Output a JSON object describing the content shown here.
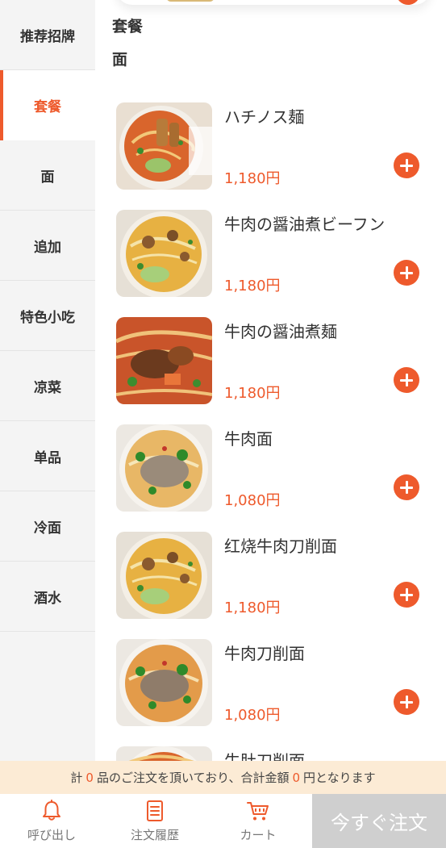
{
  "sidebar": {
    "items": [
      {
        "label": "推荐招牌",
        "active": false
      },
      {
        "label": "套餐",
        "active": true
      },
      {
        "label": "面",
        "active": false
      },
      {
        "label": "追加",
        "active": false
      },
      {
        "label": "特色小吃",
        "active": false
      },
      {
        "label": "凉菜",
        "active": false
      },
      {
        "label": "单品",
        "active": false
      },
      {
        "label": "冷面",
        "active": false
      },
      {
        "label": "酒水",
        "active": false
      }
    ]
  },
  "main": {
    "section_titles": [
      "套餐",
      "面"
    ],
    "dishes": [
      {
        "name": "ハチノス麺",
        "price": "1,180円",
        "image": "noodle-soup-photo"
      },
      {
        "name": "牛肉の醤油煮ビーフン",
        "price": "1,180円",
        "image": "noodle-soup-photo"
      },
      {
        "name": "牛肉の醤油煮麺",
        "price": "1,180円",
        "image": "noodle-soup-photo"
      },
      {
        "name": "牛肉面",
        "price": "1,080円",
        "image": "noodle-soup-photo"
      },
      {
        "name": "红烧牛肉刀削面",
        "price": "1,180円",
        "image": "noodle-soup-photo"
      },
      {
        "name": "牛肉刀削面",
        "price": "1,080円",
        "image": "noodle-soup-photo"
      },
      {
        "name": "牛肚刀削面",
        "price": "",
        "image": "noodle-soup-photo"
      }
    ]
  },
  "summary": {
    "prefix": "計",
    "count": "0",
    "middle": "品のご注文を頂いており、合計金額",
    "amount": "0",
    "suffix": "円となります"
  },
  "bottom_nav": {
    "items": [
      {
        "label": "呼び出し",
        "icon": "bell-icon"
      },
      {
        "label": "注文履歴",
        "icon": "order-history-icon"
      },
      {
        "label": "カート",
        "icon": "cart-icon"
      }
    ],
    "order_button": "今すぐ注文"
  },
  "colors": {
    "accent": "#ee5a2c",
    "sidebar_bg": "#f4f4f4",
    "summary_bg": "#fcebd5",
    "order_button_bg": "#cfcfcf"
  }
}
